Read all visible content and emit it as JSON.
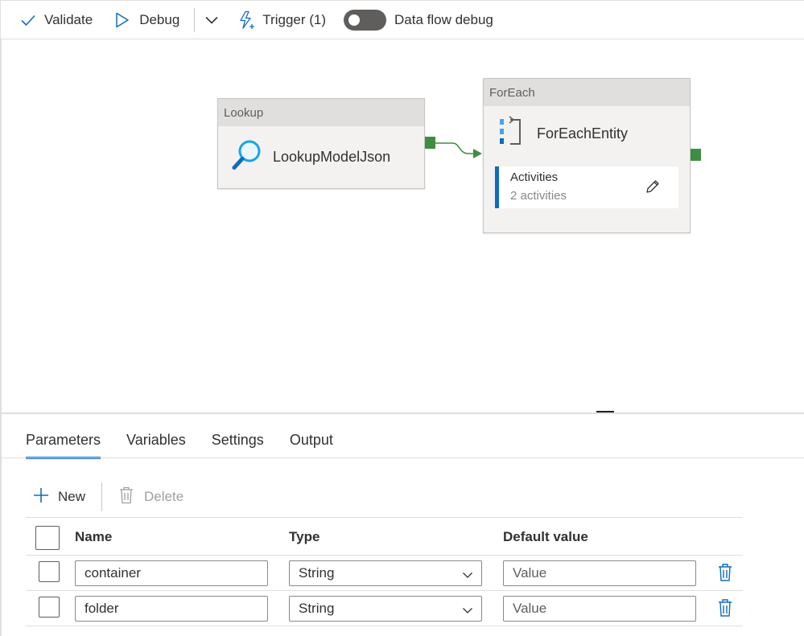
{
  "toolbar": {
    "validate_label": "Validate",
    "debug_label": "Debug",
    "trigger_label": "Trigger (1)",
    "dataflow_debug_label": "Data flow debug",
    "dataflow_debug_on": false
  },
  "canvas": {
    "lookup": {
      "type_label": "Lookup",
      "name": "LookupModelJson",
      "icon": "lookup-search-icon"
    },
    "foreach": {
      "type_label": "ForEach",
      "name": "ForEachEntity",
      "icon": "foreach-icon",
      "activities_title": "Activities",
      "activities_count": "2 activities"
    }
  },
  "panel": {
    "tabs": [
      {
        "label": "Parameters",
        "active": true
      },
      {
        "label": "Variables",
        "active": false
      },
      {
        "label": "Settings",
        "active": false
      },
      {
        "label": "Output",
        "active": false
      }
    ],
    "new_label": "New",
    "delete_label": "Delete",
    "columns": {
      "name": "Name",
      "type": "Type",
      "default": "Default value"
    },
    "rows": [
      {
        "name": "container",
        "type": "String",
        "default_placeholder": "Value"
      },
      {
        "name": "folder",
        "type": "String",
        "default_placeholder": "Value"
      }
    ]
  },
  "colors": {
    "accent": "#0f6cbd",
    "port": "#3e8e41",
    "connector": "#3e8e41",
    "lookup_icon": "#19a3e6"
  }
}
